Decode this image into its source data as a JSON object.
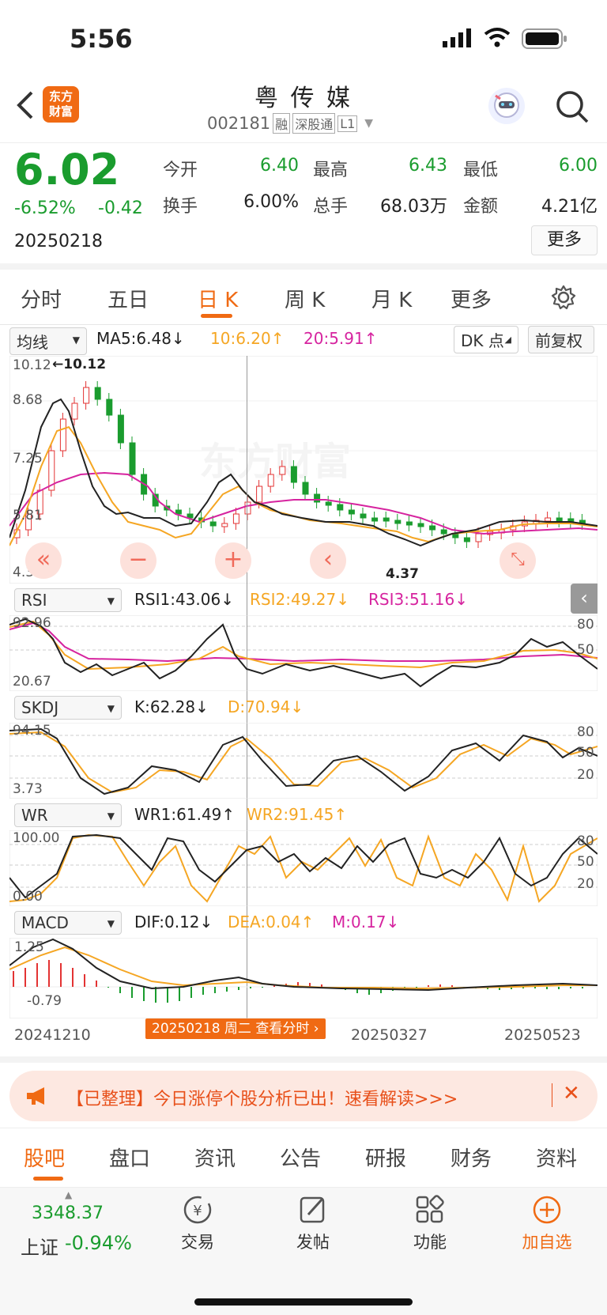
{
  "status_bar": {
    "time": "5:56"
  },
  "header": {
    "logo_text": "东方\n财富",
    "stock_name": "粤 传 媒",
    "code": "002181",
    "tags": [
      "融",
      "深股通",
      "L1"
    ]
  },
  "quote": {
    "price": "6.02",
    "change_pct": "-6.52%",
    "change_amt": "-0.42",
    "date": "20250218",
    "fields": [
      {
        "label": "今开",
        "value": "6.40"
      },
      {
        "label": "最高",
        "value": "6.43"
      },
      {
        "label": "最低",
        "value": "6.00"
      },
      {
        "label": "换手",
        "value": "6.00%"
      },
      {
        "label": "总手",
        "value": "68.03万"
      },
      {
        "label": "金额",
        "value": "4.21亿"
      }
    ],
    "more_label": "更多"
  },
  "tabs": [
    "分时",
    "五日",
    "日 K",
    "周 K",
    "月 K",
    "更多"
  ],
  "chart_bar": {
    "ma_select": "均线",
    "ma5": "MA5:6.48↓",
    "ma10": "10:6.20↑",
    "ma20": "20:5.91↑",
    "dk": "DK 点",
    "adj": "前复权",
    "colors": {
      "ma5": "#222222",
      "ma10": "#f5a623",
      "ma20": "#d6249f",
      "up": "#e33333",
      "down": "#1a9c2e"
    }
  },
  "main_chart": {
    "y_labels": [
      "10.12",
      "8.68",
      "7.25",
      "5.81",
      "4.37"
    ],
    "high_marker": "←10.12",
    "low_marker": "4.37",
    "watermark": "东方财富"
  },
  "rsi": {
    "select": "RSI",
    "v1": "RSI1:43.06↓",
    "v2": "RSI2:49.27↓",
    "v3": "RSI3:51.16↓",
    "ymax": "92.96",
    "ymin": "20.67",
    "r80": "80",
    "r50": "50"
  },
  "skdj": {
    "select": "SKDJ",
    "k": "K:62.28↓",
    "d": "D:70.94↓",
    "ymax": "94.15",
    "ymin": "3.73",
    "r80": "80",
    "r50": "50",
    "r20": "20"
  },
  "wr": {
    "select": "WR",
    "w1": "WR1:61.49↑",
    "w2": "WR2:91.45↑",
    "ymax": "100.00",
    "ymin": "0.00",
    "r80": "80",
    "r50": "50",
    "r20": "20"
  },
  "macd": {
    "select": "MACD",
    "dif": "DIF:0.12↓",
    "dea": "DEA:0.04↑",
    "m": "M:0.17↓",
    "ymax": "1.25",
    "ymin": "-0.79"
  },
  "x_axis": {
    "start": "20241210",
    "mid": "20250327",
    "end": "20250523",
    "cursor": "20250218 周二 查看分时"
  },
  "banner": {
    "text": "【已整理】今日涨停个股分析已出！速看解读>>>"
  },
  "bottom_tabs": [
    "股吧",
    "盘口",
    "资讯",
    "公告",
    "研报",
    "财务",
    "资料"
  ],
  "dock": {
    "index_value": "3348.37",
    "index_label": "上证",
    "index_change": "-0.94%",
    "items": [
      "交易",
      "发帖",
      "功能",
      "加自选"
    ]
  }
}
